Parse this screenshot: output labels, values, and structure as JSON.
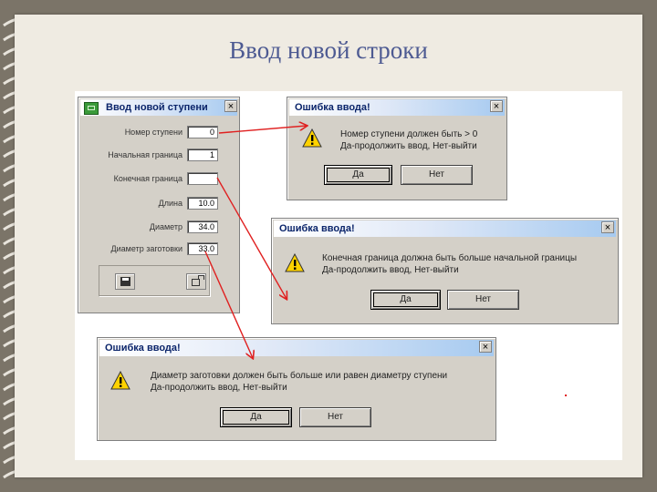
{
  "slide": {
    "title": "Ввод новой строки"
  },
  "form": {
    "title": "Ввод новой ступени",
    "close": "×",
    "fields": [
      {
        "label": "Номер ступени",
        "value": "0"
      },
      {
        "label": "Начальная граница",
        "value": "1"
      },
      {
        "label": "Конечная граница",
        "value": ""
      },
      {
        "label": "Длина",
        "value": "10.0"
      },
      {
        "label": "Диаметр",
        "value": "34.0"
      },
      {
        "label": "Диаметр заготовки",
        "value": "33.0"
      }
    ],
    "toolbar": {
      "save_icon": "save-icon",
      "exit_icon": "exit-icon"
    }
  },
  "errors": [
    {
      "title": "Ошибка ввода!",
      "close": "×",
      "line1": "Номер ступени должен быть > 0",
      "line2": "Да-продолжить ввод, Нет-выйти",
      "yes": "Да",
      "no": "Нет"
    },
    {
      "title": "Ошибка ввода!",
      "close": "×",
      "line1": "Конечная граница должна быть больше начальной границы",
      "line2": "Да-продолжить ввод, Нет-выйти",
      "yes": "Да",
      "no": "Нет"
    },
    {
      "title": "Ошибка ввода!",
      "close": "×",
      "line1": "Диаметр заготовки должен быть больше или равен диаметру ступени",
      "line2": "Да-продолжить ввод, Нет-выйти",
      "yes": "Да",
      "no": "Нет"
    }
  ],
  "colors": {
    "arrow": "#e02020",
    "title": "#4d5a92",
    "page": "#efebe2"
  }
}
